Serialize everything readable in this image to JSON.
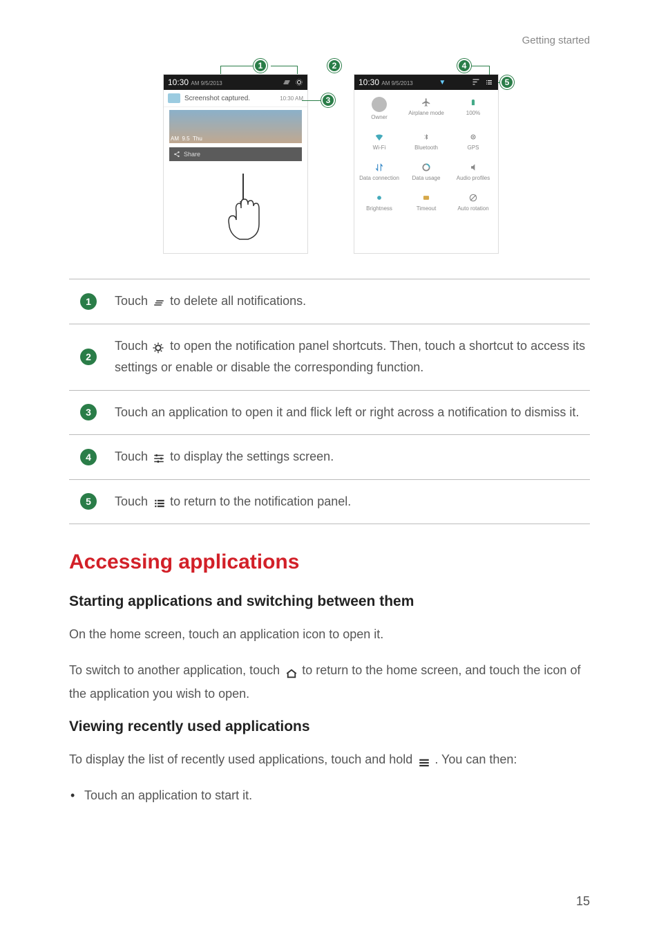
{
  "header": {
    "chapter": "Getting started"
  },
  "figure": {
    "callouts": [
      "1",
      "2",
      "3",
      "4",
      "5"
    ],
    "left_panel": {
      "time": "10:30",
      "time_suffix": "AM 9/5/2013",
      "notif_title": "Screenshot captured.",
      "notif_time": "10:30 AM",
      "thumb_left": "AM",
      "thumb_mid": "9.5",
      "thumb_right": "Thu",
      "share_label": "Share"
    },
    "right_panel": {
      "time": "10:30",
      "time_suffix": "AM 9/5/2013",
      "cells": [
        {
          "label": "Owner"
        },
        {
          "label": "Airplane mode"
        },
        {
          "label": "100%"
        },
        {
          "label": "Wi-Fi"
        },
        {
          "label": "Bluetooth"
        },
        {
          "label": "GPS"
        },
        {
          "label": "Data connection"
        },
        {
          "label": "Data usage"
        },
        {
          "label": "Audio profiles"
        },
        {
          "label": "Brightness"
        },
        {
          "label": "Timeout"
        },
        {
          "label": "Auto rotation"
        }
      ]
    }
  },
  "rows": [
    {
      "num": "1",
      "pre": "Touch ",
      "post": " to delete all notifications."
    },
    {
      "num": "2",
      "pre": "Touch ",
      "mid": " to open the notification panel shortcuts. Then, touch a shortcut to access its settings or enable or disable the corresponding function."
    },
    {
      "num": "3",
      "text": "Touch an application to open it and flick left or right across a notification to dismiss it."
    },
    {
      "num": "4",
      "pre": "Touch ",
      "post": " to display the settings screen."
    },
    {
      "num": "5",
      "pre": "Touch ",
      "post": "to return to the notification panel."
    }
  ],
  "section_title": "Accessing applications",
  "sub1": {
    "title": "Starting applications and switching between them",
    "p1": "On the home screen, touch an application icon to open it.",
    "p2_pre": "To switch to another application, touch ",
    "p2_post": "to return to the home screen, and touch the icon of the application you wish to open."
  },
  "sub2": {
    "title": "Viewing recently used applications",
    "p_pre": "To display the list of recently used applications, touch and hold ",
    "p_post": " . You can then:",
    "bullet1": "Touch an application to start it."
  },
  "page_number": "15"
}
